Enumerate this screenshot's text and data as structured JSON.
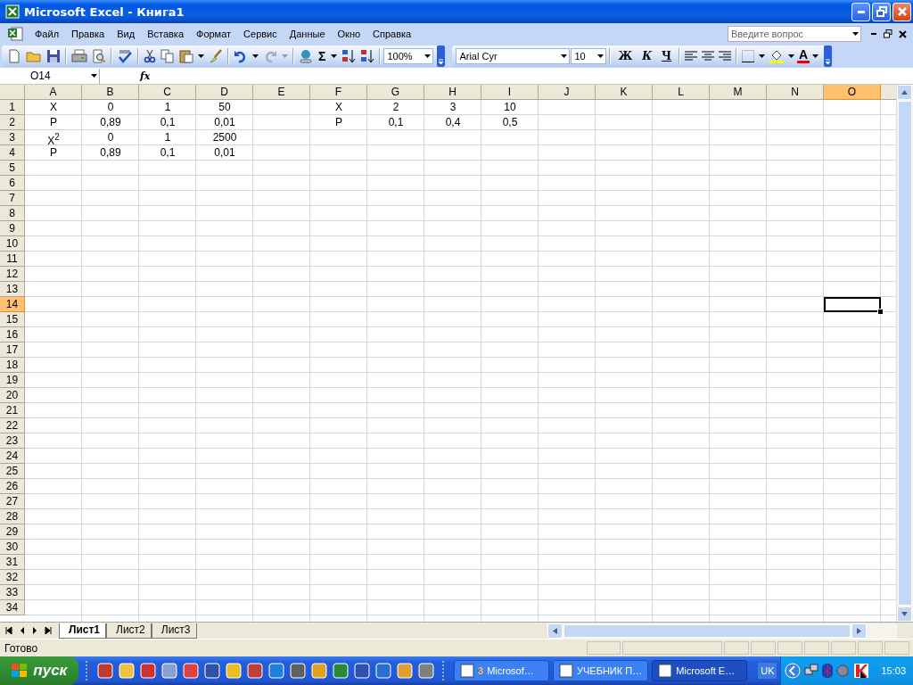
{
  "window": {
    "title": "Microsoft Excel - Книга1"
  },
  "menu": [
    {
      "label": "Файл"
    },
    {
      "label": "Правка"
    },
    {
      "label": "Вид"
    },
    {
      "label": "Вставка"
    },
    {
      "label": "Формат"
    },
    {
      "label": "Сервис"
    },
    {
      "label": "Данные"
    },
    {
      "label": "Окно"
    },
    {
      "label": "Справка"
    }
  ],
  "help_box": {
    "placeholder": "Введите вопрос"
  },
  "standard_toolbar": {
    "sum_label": "Σ",
    "zoom": "100%"
  },
  "formatting_toolbar": {
    "font": "Arial Cyr",
    "size": "10",
    "bold_label": "Ж",
    "italic_label": "К",
    "underline_label": "Ч",
    "font_color_label": "A"
  },
  "formula_bar": {
    "name_box": "O14",
    "fx_label": "fx"
  },
  "grid": {
    "columns": [
      {
        "label": "A",
        "selected": false
      },
      {
        "label": "B",
        "selected": false
      },
      {
        "label": "C",
        "selected": false
      },
      {
        "label": "D",
        "selected": false
      },
      {
        "label": "E",
        "selected": false
      },
      {
        "label": "F",
        "selected": false
      },
      {
        "label": "G",
        "selected": false
      },
      {
        "label": "H",
        "selected": false
      },
      {
        "label": "I",
        "selected": false
      },
      {
        "label": "J",
        "selected": false
      },
      {
        "label": "K",
        "selected": false
      },
      {
        "label": "L",
        "selected": false
      },
      {
        "label": "M",
        "selected": false
      },
      {
        "label": "N",
        "selected": false
      },
      {
        "label": "O",
        "selected": true
      }
    ],
    "rows": [
      {
        "number": "1",
        "selected": false,
        "cells": [
          "X",
          "0",
          "1",
          "50",
          null,
          "X",
          "2",
          "3",
          "10"
        ]
      },
      {
        "number": "2",
        "selected": false,
        "cells": [
          "P",
          "0,89",
          "0,1",
          "0,01",
          null,
          "P",
          "0,1",
          "0,4",
          "0,5"
        ]
      },
      {
        "number": "3",
        "selected": false,
        "cells": [
          "X$^{2}$",
          "0",
          "1",
          "2500"
        ]
      },
      {
        "number": "4",
        "selected": false,
        "cells": [
          "P",
          "0,89",
          "0,1",
          "0,01"
        ]
      },
      {
        "number": "5",
        "selected": false
      },
      {
        "number": "6",
        "selected": false
      },
      {
        "number": "7",
        "selected": false
      },
      {
        "number": "8",
        "selected": false
      },
      {
        "number": "9",
        "selected": false
      },
      {
        "number": "10",
        "selected": false
      },
      {
        "number": "11",
        "selected": false
      },
      {
        "number": "12",
        "selected": false
      },
      {
        "number": "13",
        "selected": false
      },
      {
        "number": "14",
        "selected": true
      },
      {
        "number": "15",
        "selected": false
      },
      {
        "number": "16",
        "selected": false
      },
      {
        "number": "17",
        "selected": false
      },
      {
        "number": "18",
        "selected": false
      },
      {
        "number": "19",
        "selected": false
      },
      {
        "number": "20",
        "selected": false
      },
      {
        "number": "21",
        "selected": false
      },
      {
        "number": "22",
        "selected": false
      },
      {
        "number": "23",
        "selected": false
      },
      {
        "number": "24",
        "selected": false
      },
      {
        "number": "25",
        "selected": false
      },
      {
        "number": "26",
        "selected": false
      },
      {
        "number": "27",
        "selected": false
      },
      {
        "number": "28",
        "selected": false
      },
      {
        "number": "29",
        "selected": false
      },
      {
        "number": "30",
        "selected": false
      },
      {
        "number": "31",
        "selected": false
      },
      {
        "number": "32",
        "selected": false
      },
      {
        "number": "33",
        "selected": false
      },
      {
        "number": "34",
        "selected": false
      }
    ]
  },
  "sheet_tabs": [
    {
      "label": "Лист1",
      "selected": true
    },
    {
      "label": "Лист2",
      "selected": false
    },
    {
      "label": "Лист3",
      "selected": false
    }
  ],
  "status_bar": {
    "text": "Готово"
  },
  "taskbar": {
    "start": "пуск",
    "tasks": [
      {
        "count": "3",
        "label": "Microsof…",
        "selected": false
      },
      {
        "label": "УЧЕБНИК П…",
        "selected": false
      },
      {
        "label": "Microsoft E…",
        "selected": true
      }
    ],
    "language": "UK",
    "clock": "15:03"
  }
}
